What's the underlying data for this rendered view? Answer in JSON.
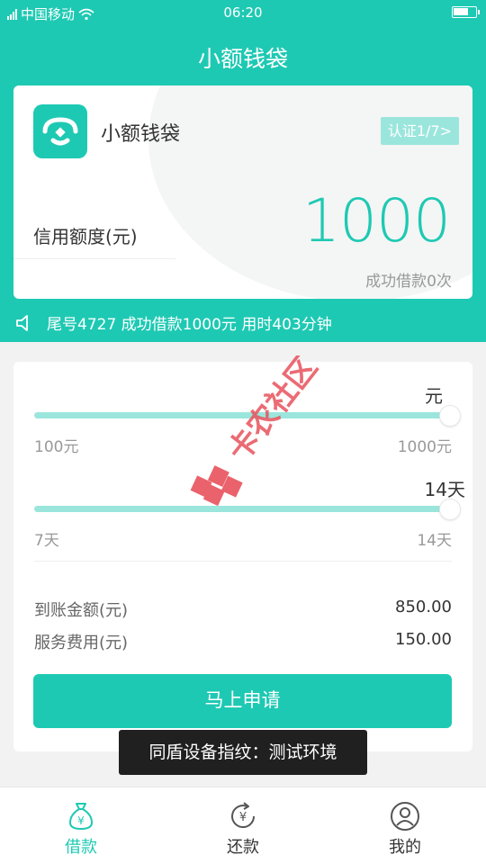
{
  "status_bar": {
    "carrier": "中国移动",
    "time": "06:20"
  },
  "header": {
    "title": "小额钱袋"
  },
  "card": {
    "app_name": "小额钱袋",
    "verify_label": "认证1/7>",
    "limit_label": "信用额度(元)",
    "limit_value": "1000",
    "loan_count": "成功借款0次"
  },
  "notice": {
    "text": "尾号4727 成功借款1000元 用时403分钟"
  },
  "loan": {
    "amount_value_label": "元",
    "amount_min": "100元",
    "amount_max": "1000元",
    "amount_level": 1.0,
    "days_value_label": "14天",
    "days_min": "7天",
    "days_max": "14天",
    "days_level": 1.0,
    "received_label": "到账金额(元)",
    "received_value": "850.00",
    "fee_label": "服务费用(元)",
    "fee_value": "150.00",
    "apply_label": "马上申请"
  },
  "watermark": {
    "text": "卡农社区"
  },
  "toast": {
    "text": "同盾设备指纹：测试环境"
  },
  "tabs": [
    {
      "label": "借款",
      "icon": "money-bag-icon",
      "active": true
    },
    {
      "label": "还款",
      "icon": "repay-icon",
      "active": false
    },
    {
      "label": "我的",
      "icon": "user-icon",
      "active": false
    }
  ],
  "colors": {
    "accent": "#1ec9b3",
    "accent_light": "#9be6dc"
  }
}
